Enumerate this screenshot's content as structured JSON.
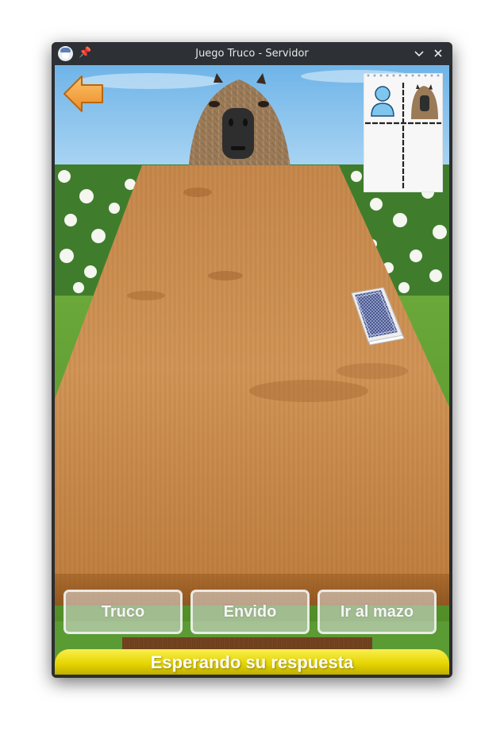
{
  "window": {
    "title": "Juego Truco - Servidor",
    "icons": [
      "app-icon",
      "pin-icon",
      "minimize-chevron-icon",
      "close-icon"
    ]
  },
  "game": {
    "back_icon": "back-arrow-icon",
    "scorepad": {
      "player_icon": "person-icon",
      "opponent_icon": "capybara-avatar-icon",
      "player_score": "",
      "opponent_score": ""
    },
    "opponent": "capybara",
    "deck": "face-down deck of cards",
    "buttons": {
      "truco": "Truco",
      "envido": "Envido",
      "mazo": "Ir al mazo"
    },
    "status": "Esperando su respuesta"
  },
  "colors": {
    "status_bar": "#e5d400",
    "back_arrow": "#f4a13b",
    "table_wood": "#c98b47",
    "sky": "#8bc4ea",
    "grass": "#5c9a2f"
  }
}
